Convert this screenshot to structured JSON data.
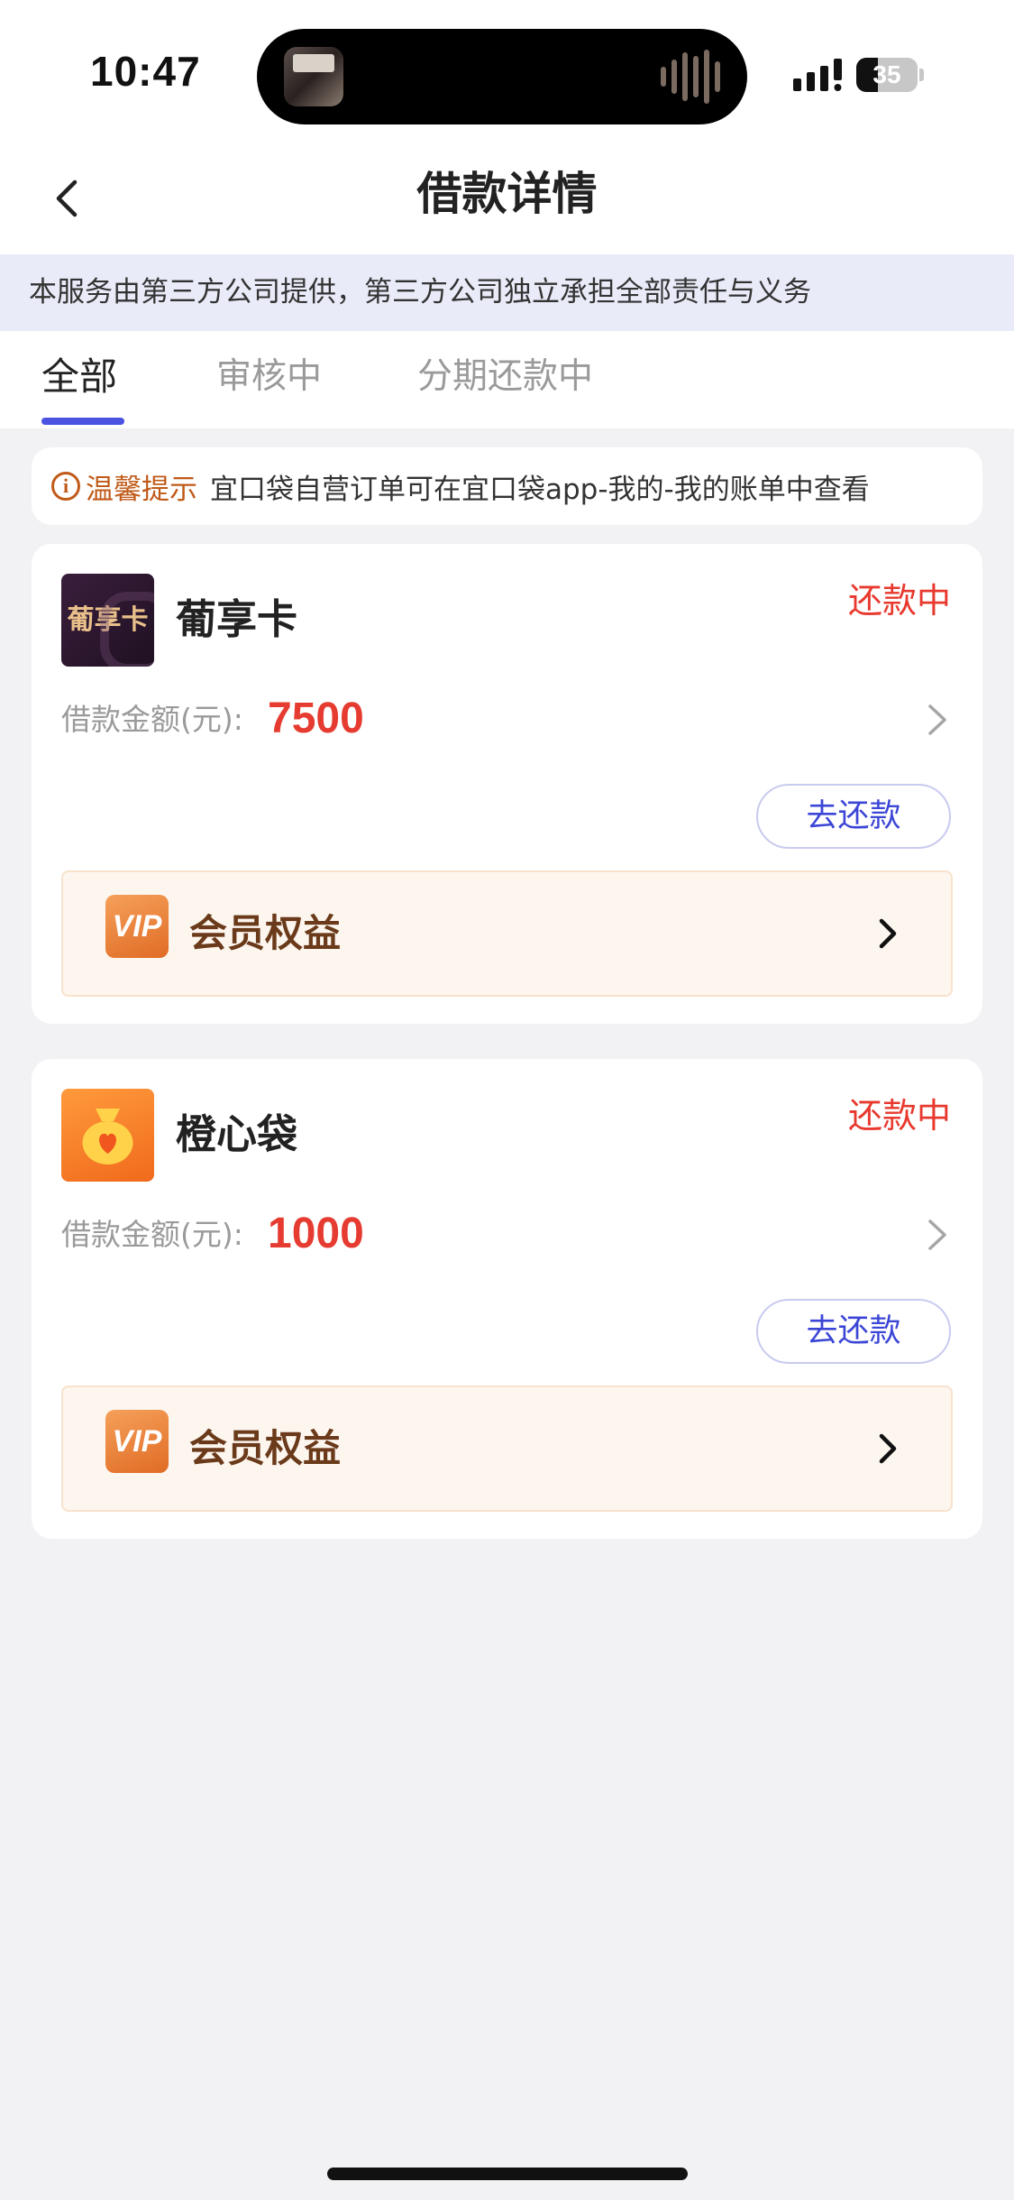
{
  "status_bar": {
    "time": "10:47",
    "battery": "35"
  },
  "nav": {
    "title": "借款详情"
  },
  "notice": {
    "text": "本服务由第三方公司提供，第三方公司独立承担全部责任与义务"
  },
  "tabs": [
    {
      "label": "全部",
      "active": true
    },
    {
      "label": "审核中",
      "active": false
    },
    {
      "label": "分期还款中",
      "active": false
    }
  ],
  "tip": {
    "label": "温馨提示",
    "text": "宜口袋自营订单可在宜口袋app-我的-我的账单中查看"
  },
  "loans": [
    {
      "logo_text": "葡享卡",
      "name": "葡享卡",
      "status": "还款中",
      "amount_label": "借款金额(元):",
      "amount": "7500",
      "repay_label": "去还款",
      "vip_label": "会员权益",
      "vip_badge": "VIP"
    },
    {
      "logo_text": "",
      "name": "橙心袋",
      "status": "还款中",
      "amount_label": "借款金额(元):",
      "amount": "1000",
      "repay_label": "去还款",
      "vip_label": "会员权益",
      "vip_badge": "VIP"
    }
  ],
  "colors": {
    "accent": "#4a54e1",
    "status_red": "#e8392e",
    "tip_orange": "#c05a18",
    "vip_brown": "#6a3a1a"
  },
  "icons": {
    "back": "chevron-left-icon",
    "tip": "info-circle-icon",
    "detail": "chevron-right-icon",
    "vip": "vip-badge-icon",
    "orange_logo": "money-bag-heart-icon"
  }
}
